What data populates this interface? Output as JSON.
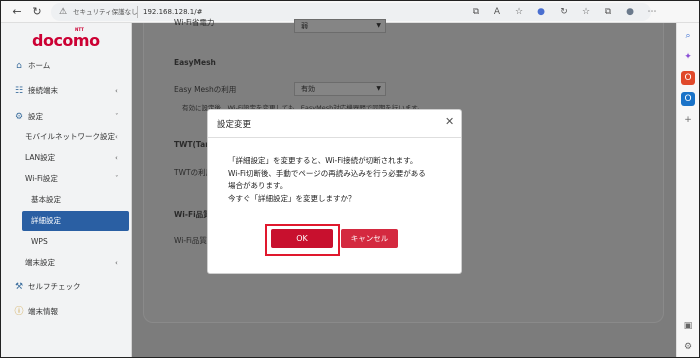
{
  "browser": {
    "security_label": "セキュリティ保護なし",
    "url": "192.168.128.1/#",
    "back_icon": "arrow-left-icon",
    "reload_icon": "reload-icon"
  },
  "sidebar": {
    "logo": "docomo",
    "logo_sup": "NTT",
    "items": [
      {
        "label": "ホーム",
        "icon": "home-icon"
      },
      {
        "label": "接続端末",
        "icon": "network-icon",
        "chevron": "‹"
      },
      {
        "label": "設定",
        "icon": "gear-icon",
        "chevron": "ˇ"
      },
      {
        "label": "モバイルネットワーク設定",
        "chevron": "‹"
      },
      {
        "label": "LAN設定",
        "chevron": "‹"
      },
      {
        "label": "Wi-Fi設定",
        "chevron": "ˇ"
      },
      {
        "label": "基本設定"
      },
      {
        "label": "詳細設定"
      },
      {
        "label": "WPS"
      },
      {
        "label": "端末設定",
        "chevron": "‹"
      },
      {
        "label": "セルフチェック",
        "icon": "wrench-icon"
      },
      {
        "label": "端末情報",
        "icon": "info-icon"
      }
    ]
  },
  "main": {
    "top_select_label": "Wi-Fi省電力",
    "top_select_value": "弱",
    "easymesh_heading": "EasyMesh",
    "easymesh_label": "Easy Meshの利用",
    "easymesh_value": "有効",
    "easymesh_note": "有効に設定後、Wi-Fi設定を変更しても、EasyMesh対応機器間で同期を行います。",
    "twt_heading": "TWT(Target Wake Time)",
    "twt_label": "TWTの利用",
    "quality_heading": "Wi-Fi品質",
    "quality_label": "Wi-Fi品質改善"
  },
  "dialog": {
    "title": "設定変更",
    "lines": [
      "「詳細設定」を変更すると、Wi-Fi接続が切断されます。",
      "Wi-Fi切断後、手動でページの再読み込みを行う必要がある",
      "場合があります。",
      "今すぐ「詳細設定」を変更しますか？"
    ],
    "ok_label": "OK",
    "cancel_label": "キャンセル"
  },
  "colors": {
    "brand": "#cc0033",
    "active_nav": "#2a5fa3",
    "ok_button": "#c8102e",
    "cancel_button": "#d4293f",
    "highlight": "#e0182d"
  }
}
